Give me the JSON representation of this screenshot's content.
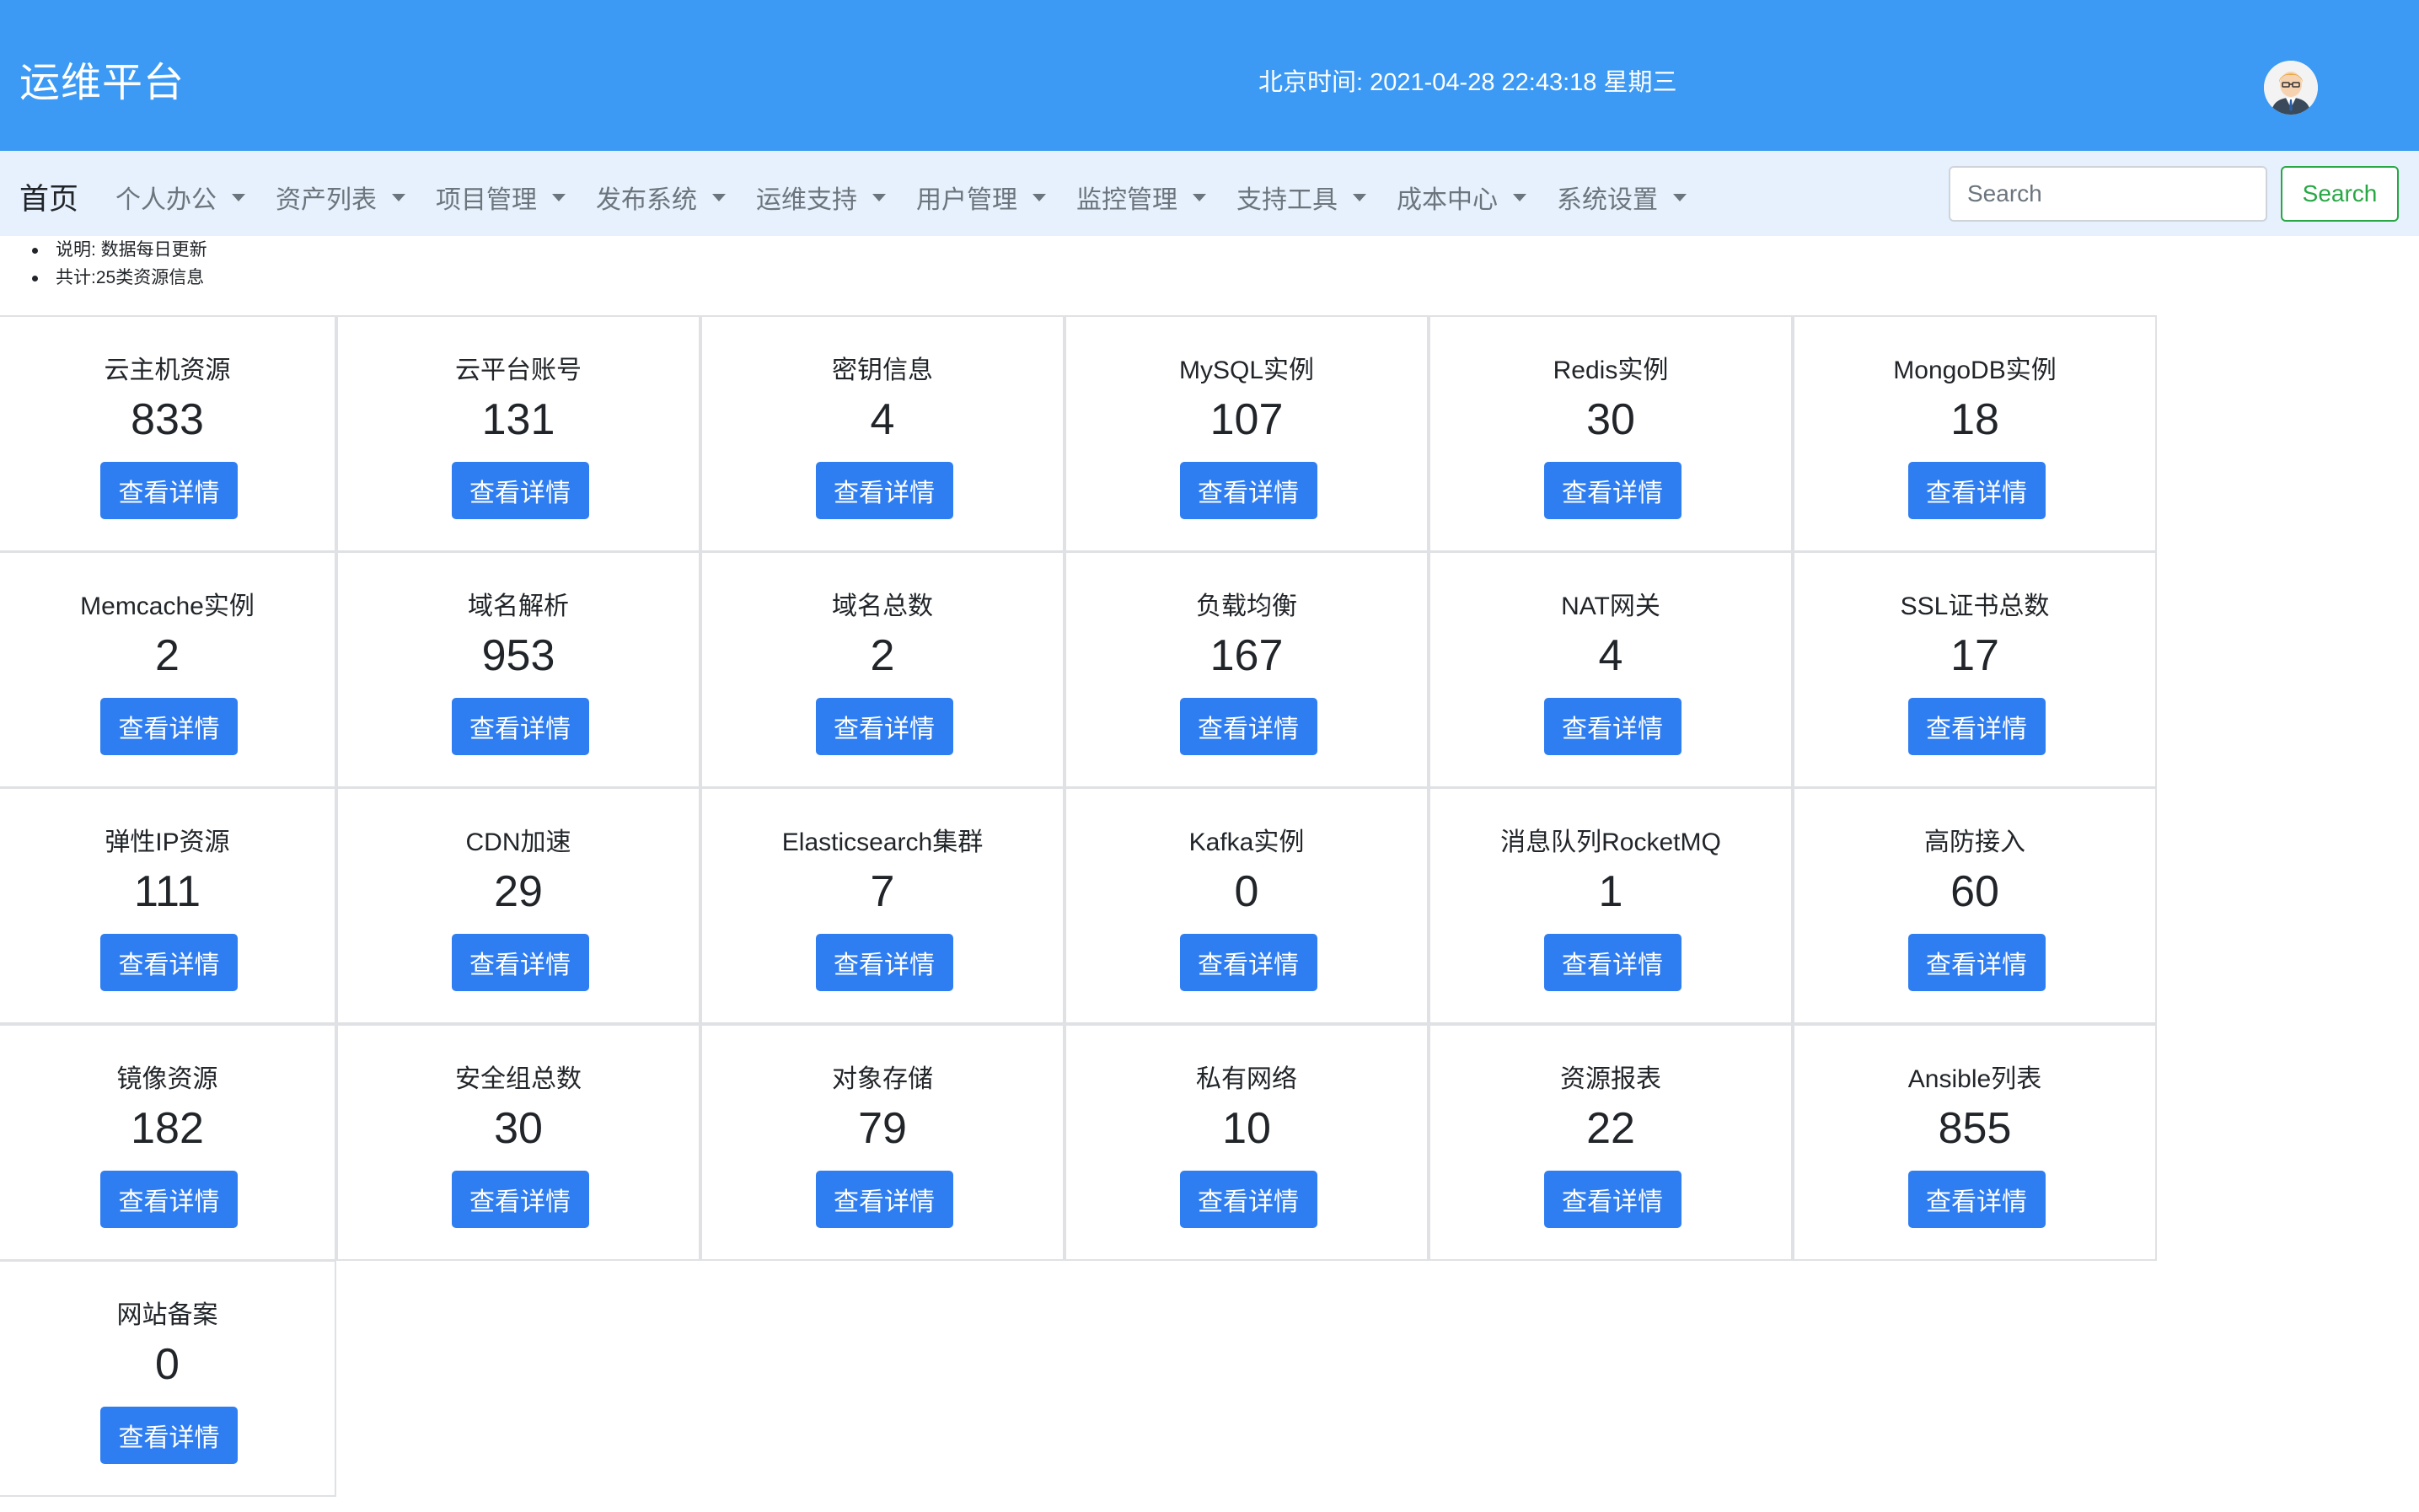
{
  "header": {
    "brand": "运维平台",
    "clock": "北京时间: 2021-04-28 22:43:18 星期三",
    "bg_color": "#3c9af4"
  },
  "navbar": {
    "home": "首页",
    "menus": [
      "个人办公",
      "资产列表",
      "项目管理",
      "发布系统",
      "运维支持",
      "用户管理",
      "监控管理",
      "支持工具",
      "成本中心",
      "系统设置"
    ],
    "search_placeholder": "Search",
    "search_button": "Search"
  },
  "notes": [
    "说明: 数据每日更新",
    "共计:25类资源信息"
  ],
  "cards": [
    {
      "title": "云主机资源",
      "count": "833",
      "button": "查看详情"
    },
    {
      "title": "云平台账号",
      "count": "131",
      "button": "查看详情"
    },
    {
      "title": "密钥信息",
      "count": "4",
      "button": "查看详情"
    },
    {
      "title": "MySQL实例",
      "count": "107",
      "button": "查看详情"
    },
    {
      "title": "Redis实例",
      "count": "30",
      "button": "查看详情"
    },
    {
      "title": "MongoDB实例",
      "count": "18",
      "button": "查看详情"
    },
    {
      "title": "Memcache实例",
      "count": "2",
      "button": "查看详情"
    },
    {
      "title": "域名解析",
      "count": "953",
      "button": "查看详情"
    },
    {
      "title": "域名总数",
      "count": "2",
      "button": "查看详情"
    },
    {
      "title": "负载均衡",
      "count": "167",
      "button": "查看详情"
    },
    {
      "title": "NAT网关",
      "count": "4",
      "button": "查看详情"
    },
    {
      "title": "SSL证书总数",
      "count": "17",
      "button": "查看详情"
    },
    {
      "title": "弹性IP资源",
      "count": "111",
      "button": "查看详情"
    },
    {
      "title": "CDN加速",
      "count": "29",
      "button": "查看详情"
    },
    {
      "title": "Elasticsearch集群",
      "count": "7",
      "button": "查看详情"
    },
    {
      "title": "Kafka实例",
      "count": "0",
      "button": "查看详情"
    },
    {
      "title": "消息队列RocketMQ",
      "count": "1",
      "button": "查看详情"
    },
    {
      "title": "高防接入",
      "count": "60",
      "button": "查看详情"
    },
    {
      "title": "镜像资源",
      "count": "182",
      "button": "查看详情"
    },
    {
      "title": "安全组总数",
      "count": "30",
      "button": "查看详情"
    },
    {
      "title": "对象存储",
      "count": "79",
      "button": "查看详情"
    },
    {
      "title": "私有网络",
      "count": "10",
      "button": "查看详情"
    },
    {
      "title": "资源报表",
      "count": "22",
      "button": "查看详情"
    },
    {
      "title": "Ansible列表",
      "count": "855",
      "button": "查看详情"
    },
    {
      "title": "网站备案",
      "count": "0",
      "button": "查看详情"
    }
  ]
}
